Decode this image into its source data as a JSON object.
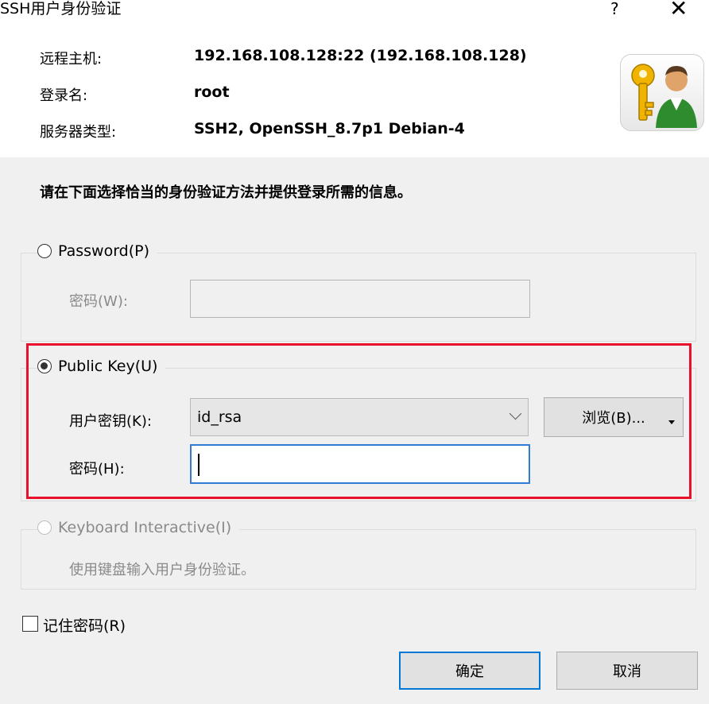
{
  "window": {
    "title": "SSH用户身份验证",
    "help": "?",
    "close": "✕"
  },
  "info": {
    "host_label": "远程主机:",
    "host_value": "192.168.108.128:22 (192.168.108.128)",
    "login_label": "登录名:",
    "login_value": "root",
    "server_label": "服务器类型:",
    "server_value": "SSH2, OpenSSH_8.7p1 Debian-4"
  },
  "instruction": "请在下面选择恰当的身份验证方法并提供登录所需的信息。",
  "password_method": {
    "label": "Password(P)",
    "selected": false,
    "field_label": "密码(W):",
    "value": ""
  },
  "public_key_method": {
    "label": "Public Key(U)",
    "selected": true,
    "key_label": "用户密钥(K):",
    "key_value": "id_rsa",
    "browse_label": "浏览(B)...",
    "passphrase_label": "密码(H):",
    "passphrase_value": ""
  },
  "keyboard_method": {
    "label": "Keyboard Interactive(I)",
    "selected": false,
    "description": "使用键盘输入用户身份验证。"
  },
  "remember_password": {
    "label": "记住密码(R)",
    "checked": false
  },
  "buttons": {
    "ok": "确定",
    "cancel": "取消"
  },
  "colors": {
    "highlight": "#e8102b",
    "focus": "#2f7bd6",
    "panel": "#f0f0f0"
  }
}
